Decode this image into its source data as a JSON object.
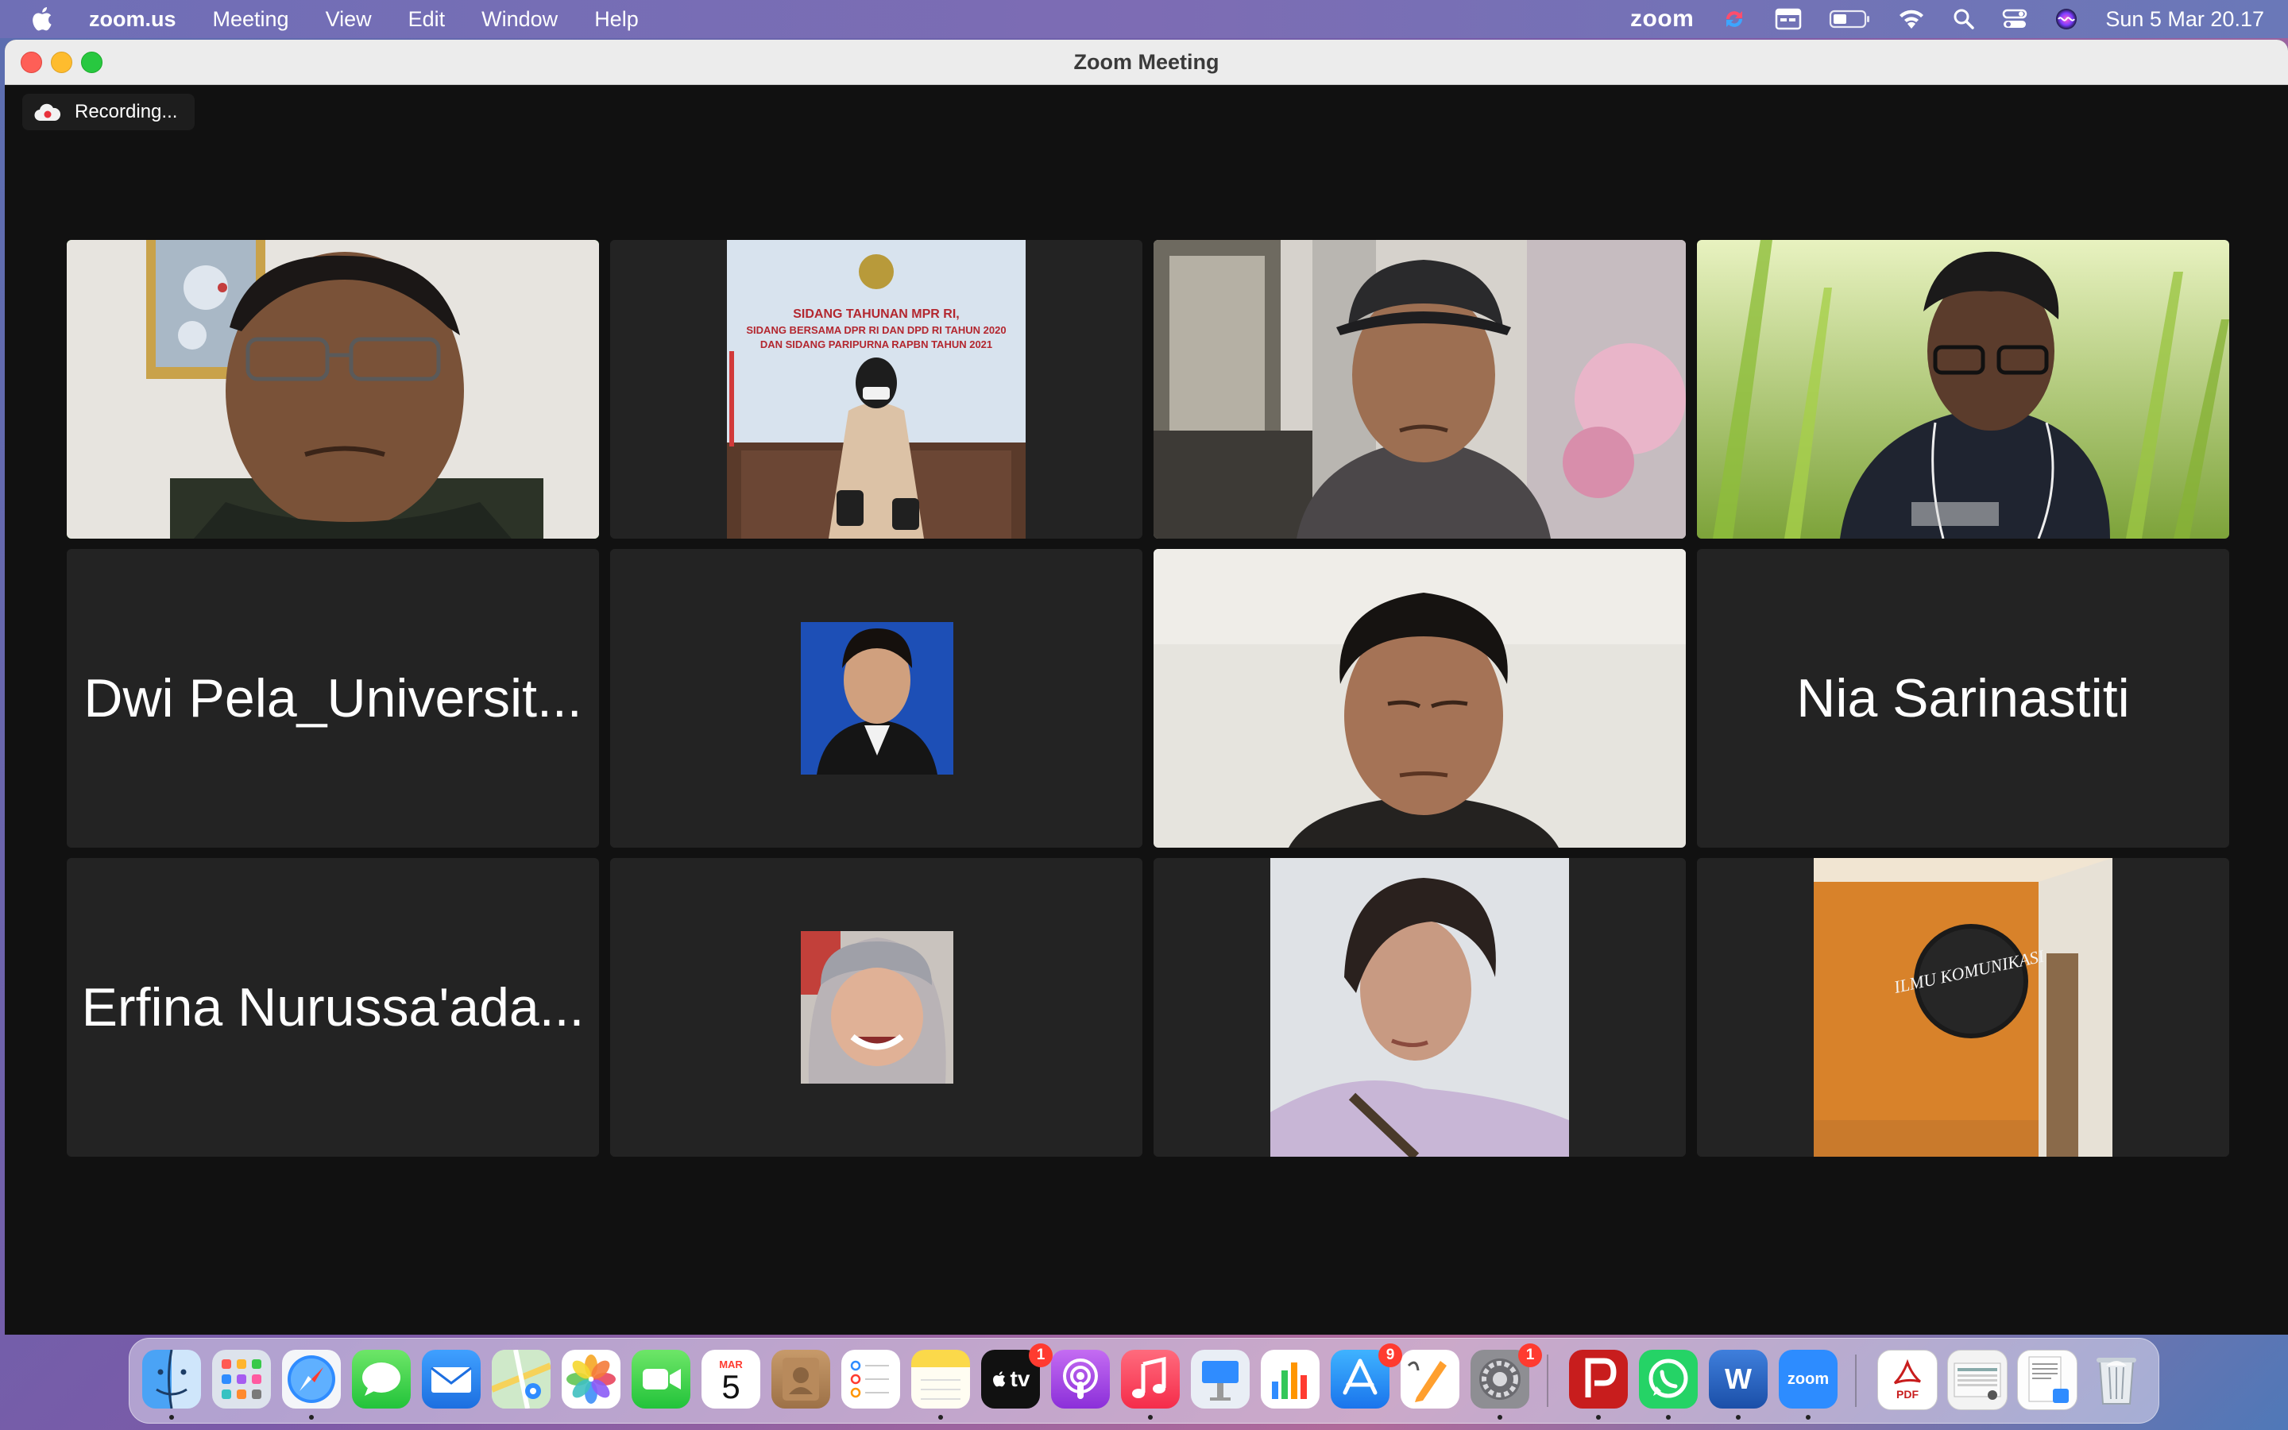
{
  "menubar": {
    "apple": "apple-icon",
    "app_name": "zoom.us",
    "menus": [
      "Meeting",
      "View",
      "Edit",
      "Window",
      "Help"
    ],
    "status_zoom_label": "zoom",
    "clock": "Sun 5 Mar  20.17"
  },
  "window": {
    "title": "Zoom Meeting",
    "recording_label": "Recording..."
  },
  "participants": [
    {
      "type": "video",
      "scene": "man-glasses-framed-picture",
      "active": true
    },
    {
      "type": "video",
      "scene": "woman-hijab-banner"
    },
    {
      "type": "video",
      "scene": "man-cap-mall"
    },
    {
      "type": "video",
      "scene": "man-glasses-grass"
    },
    {
      "type": "name",
      "name": "Dwi Pela_Universit..."
    },
    {
      "type": "photo",
      "scene": "man-blue-background"
    },
    {
      "type": "video",
      "scene": "young-man-white-wall"
    },
    {
      "type": "name",
      "name": "Nia Sarinastiti"
    },
    {
      "type": "name",
      "name": "Erfina Nurussa'ada..."
    },
    {
      "type": "photo",
      "scene": "woman-hijab-smile"
    },
    {
      "type": "photo",
      "scene": "woman-short-hair-sky"
    },
    {
      "type": "photo",
      "scene": "orange-wall-sign"
    }
  ],
  "banner_text": {
    "line1": "SIDANG TAHUNAN MPR RI,",
    "line2": "SIDANG BERSAMA DPR RI DAN DPD RI TAHUN 2020",
    "line3": "DAN SIDANG PARIPURNA RAPBN TAHUN 2021"
  },
  "sign_text": "ILMU KOMUNIKASI",
  "dock": {
    "apps": [
      {
        "name": "Finder",
        "icon": "finder-icon",
        "running": true
      },
      {
        "name": "Launchpad",
        "icon": "launchpad-icon"
      },
      {
        "name": "Safari",
        "icon": "safari-icon",
        "running": true
      },
      {
        "name": "Messages",
        "icon": "messages-icon"
      },
      {
        "name": "Mail",
        "icon": "mail-icon"
      },
      {
        "name": "Maps",
        "icon": "maps-icon"
      },
      {
        "name": "Photos",
        "icon": "photos-icon"
      },
      {
        "name": "FaceTime",
        "icon": "facetime-icon"
      },
      {
        "name": "Calendar",
        "icon": "calendar-icon",
        "month": "MAR",
        "day": "5"
      },
      {
        "name": "Contacts",
        "icon": "contacts-icon"
      },
      {
        "name": "Reminders",
        "icon": "reminders-icon"
      },
      {
        "name": "Notes",
        "icon": "notes-icon",
        "running": true
      },
      {
        "name": "TV",
        "icon": "tv-icon",
        "badge": "1",
        "label": "tv"
      },
      {
        "name": "Podcasts",
        "icon": "podcasts-icon"
      },
      {
        "name": "Music",
        "icon": "music-icon",
        "running": true
      },
      {
        "name": "Keynote",
        "icon": "keynote-icon"
      },
      {
        "name": "Numbers",
        "icon": "numbers-icon"
      },
      {
        "name": "App Store",
        "icon": "appstore-icon",
        "badge": "9"
      },
      {
        "name": "Pages",
        "icon": "pages-icon"
      },
      {
        "name": "System Preferences",
        "icon": "settings-icon",
        "badge": "1",
        "running": true
      },
      {
        "name": "PDF Reader",
        "icon": "pdf-reader-icon",
        "running": true
      },
      {
        "name": "WhatsApp",
        "icon": "whatsapp-icon",
        "running": true
      },
      {
        "name": "Word",
        "icon": "word-icon",
        "label": "W",
        "running": true
      },
      {
        "name": "Zoom",
        "icon": "zoom-icon",
        "label": "zoom",
        "running": true
      },
      {
        "name": "PDF Document",
        "icon": "pdf-file-icon",
        "label": "PDF"
      },
      {
        "name": "Screenshot",
        "icon": "screenshot-file-icon"
      },
      {
        "name": "Document",
        "icon": "document-file-icon"
      },
      {
        "name": "Trash",
        "icon": "trash-icon"
      }
    ]
  }
}
